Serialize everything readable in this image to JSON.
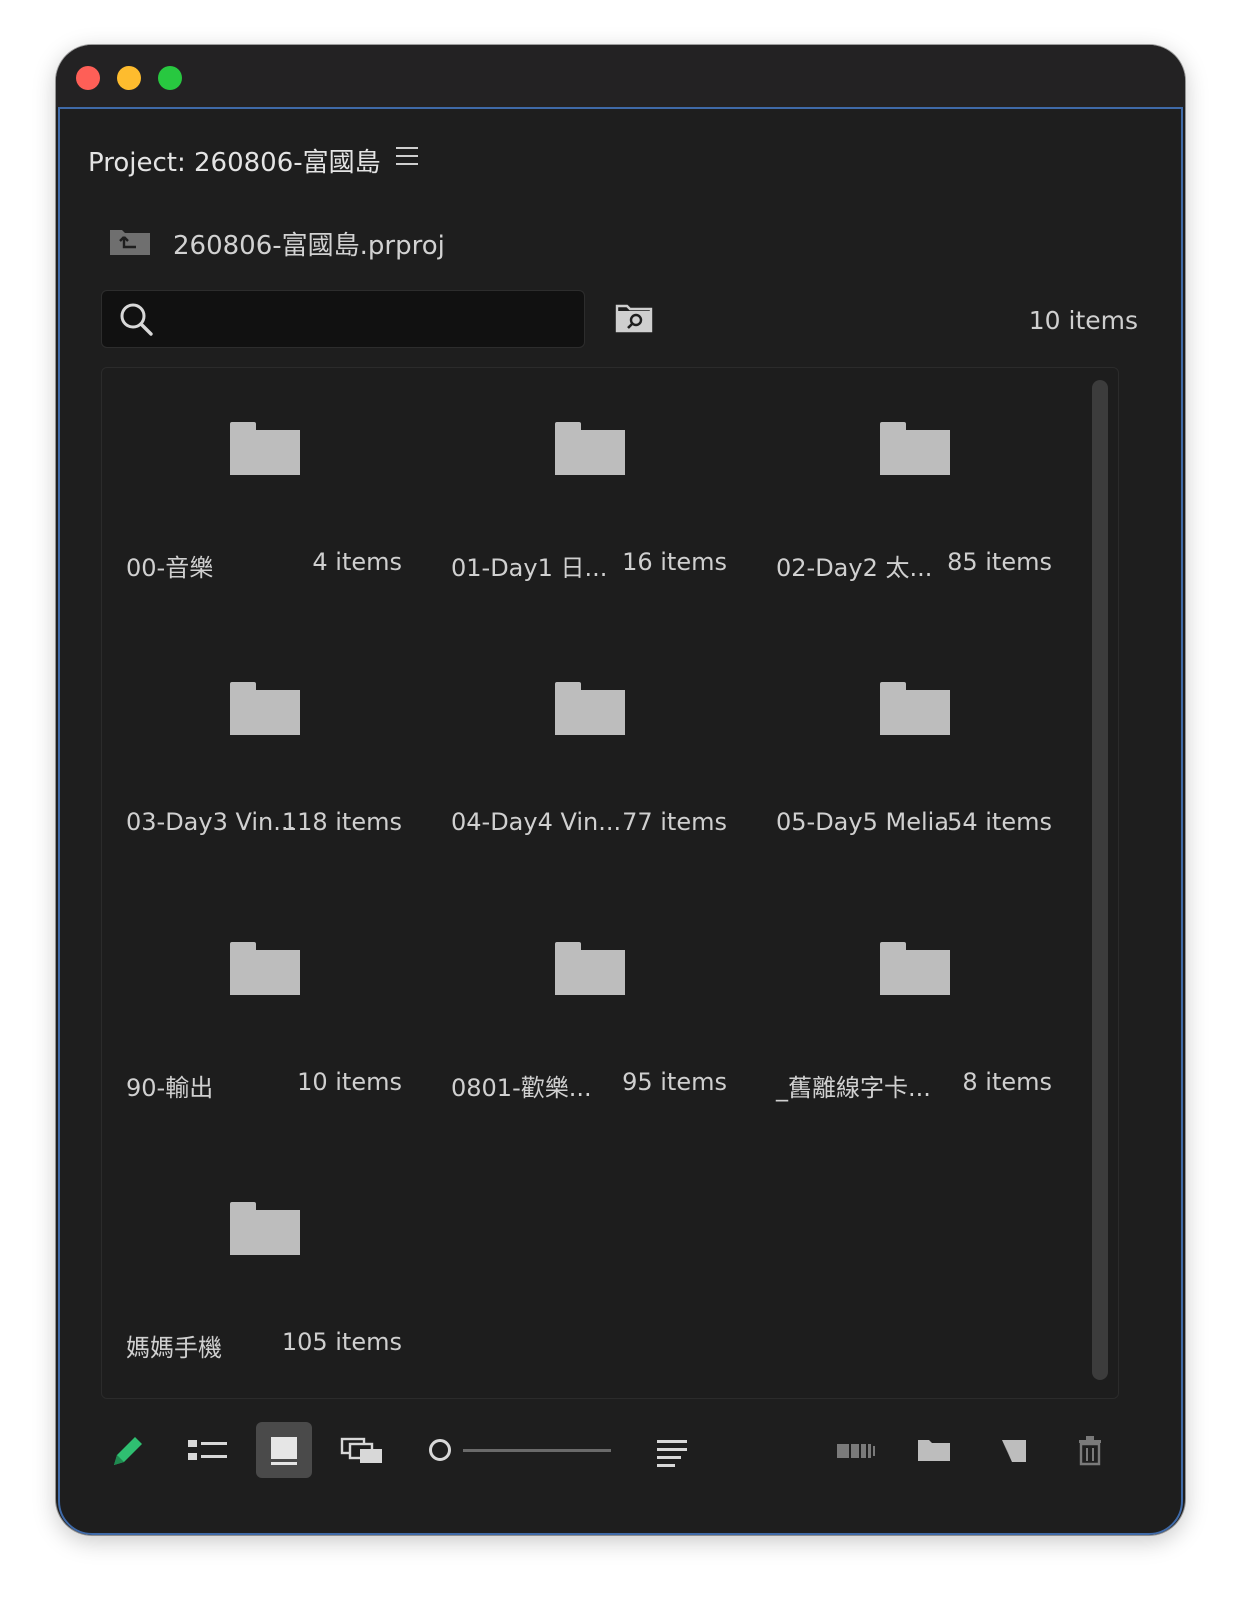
{
  "window": {
    "controls": [
      "close",
      "minimize",
      "maximize"
    ],
    "colors": {
      "close": "#fe5f57",
      "minimize": "#febc2e",
      "maximize": "#28c840",
      "panel_border": "#3f6aa8"
    }
  },
  "panel": {
    "title": "Project: 260806-富國島",
    "project_file": "260806-富國島.prproj",
    "search": {
      "value": "",
      "placeholder": ""
    },
    "item_count": "10 items"
  },
  "bins": [
    {
      "name": "00-音樂",
      "count": "4 items"
    },
    {
      "name": "01-Day1 日...",
      "count": "16 items"
    },
    {
      "name": "02-Day2 太...",
      "count": "85 items"
    },
    {
      "name": "03-Day3 Vin...",
      "count": "118 items"
    },
    {
      "name": "04-Day4 Vin...",
      "count": "77 items"
    },
    {
      "name": "05-Day5 Melia",
      "count": "54 items"
    },
    {
      "name": "90-輸出",
      "count": "10 items"
    },
    {
      "name": "0801-歡樂...",
      "count": "95 items"
    },
    {
      "name": "_舊離線字卡...",
      "count": "8 items"
    },
    {
      "name": "媽媽手機",
      "count": "105 items"
    }
  ],
  "toolbar": {
    "buttons": [
      {
        "name": "pencil-icon",
        "label": "Writable",
        "accent": "#2fbf71"
      },
      {
        "name": "list-view-icon",
        "label": "List View"
      },
      {
        "name": "icon-view-icon",
        "label": "Icon View",
        "active": true
      },
      {
        "name": "freeform-view-icon",
        "label": "Freeform View"
      },
      {
        "name": "zoom-slider",
        "label": "Zoom"
      },
      {
        "name": "sort-icon",
        "label": "Sort Icons"
      },
      {
        "name": "automate-sequence-icon",
        "label": "Automate to Sequence"
      },
      {
        "name": "new-bin-icon",
        "label": "New Bin"
      },
      {
        "name": "new-item-icon",
        "label": "New Item"
      },
      {
        "name": "trash-icon",
        "label": "Clear"
      }
    ]
  }
}
